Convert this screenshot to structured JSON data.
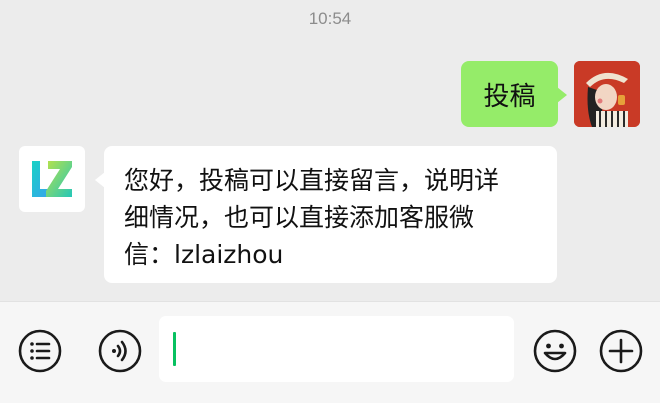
{
  "status": {
    "time": "10:54"
  },
  "messages": [
    {
      "direction": "out",
      "text": "投稿"
    },
    {
      "direction": "in",
      "lines": [
        "您好，投稿可以直接留言，说明详",
        "细情况，也可以直接添加客服微",
        "信：lzlaizhou"
      ]
    }
  ],
  "avatars": {
    "user": "portrait-avatar",
    "bot": "lz-logo-avatar"
  },
  "input_bar": {
    "left_icons": [
      "menu-list-icon",
      "voice-icon"
    ],
    "right_icons": [
      "emoji-icon",
      "plus-icon"
    ],
    "input_value": ""
  },
  "colors": {
    "background": "#ececec",
    "outgoing_bubble": "#95ec69",
    "incoming_bubble": "#ffffff",
    "caret": "#07c160"
  }
}
